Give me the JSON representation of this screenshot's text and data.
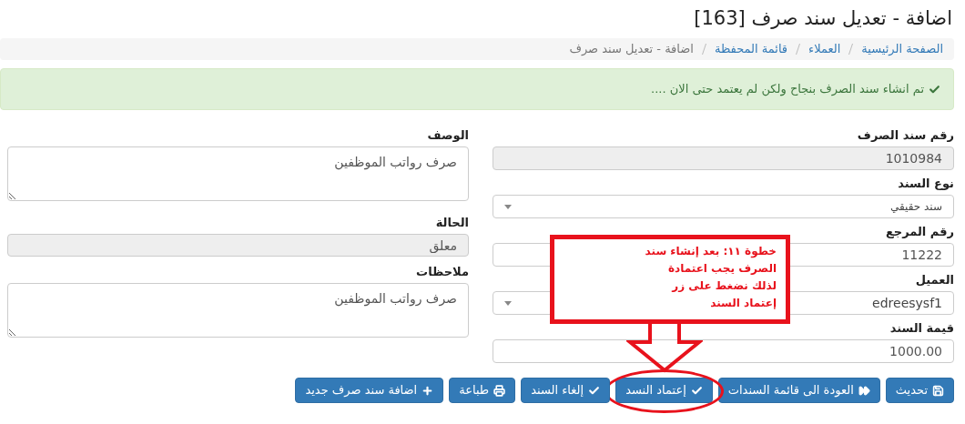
{
  "title": "اضافة - تعديل سند صرف [163]",
  "breadcrumb": [
    {
      "label": "الصفحة الرئيسية",
      "kind": "link"
    },
    {
      "label": "العملاء",
      "kind": "link"
    },
    {
      "label": "قائمة المحفظة",
      "kind": "link"
    },
    {
      "label": "اضافة - تعديل سند صرف",
      "kind": "current"
    }
  ],
  "alert": {
    "text": "تم انشاء سند الصرف بنجاح ولكن لم يعتمد حتى الان ...."
  },
  "right_fields": [
    {
      "label": "رقم سند الصرف",
      "value": "1010984",
      "kind": "input",
      "disabled": true
    },
    {
      "label": "نوع السند",
      "value": "سند حقيقي",
      "kind": "select",
      "disabled": false
    },
    {
      "label": "رقم المرجع",
      "value": "11222",
      "kind": "input",
      "disabled": false
    },
    {
      "label": "العميل",
      "value": "edreesysf1",
      "kind": "select",
      "disabled": false
    },
    {
      "label": "قيمة السند",
      "value": "1000.00",
      "kind": "input",
      "disabled": false
    }
  ],
  "left_fields": [
    {
      "label": "الوصف",
      "value": "صرف رواتب الموظفين",
      "kind": "textarea",
      "disabled": false
    },
    {
      "label": "الحالة",
      "value": "معلق",
      "kind": "input",
      "disabled": true
    },
    {
      "label": "ملاحظات",
      "value": "صرف رواتب الموظفين",
      "kind": "textarea",
      "disabled": false
    }
  ],
  "buttons": [
    {
      "label": "تحديث",
      "kind": "save",
      "highlighted": false
    },
    {
      "label": "العودة الى قائمة السندات",
      "kind": "back",
      "highlighted": false
    },
    {
      "label": "إعتماد النسد",
      "kind": "approve",
      "highlighted": true
    },
    {
      "label": "إلغاء السند",
      "kind": "cancel",
      "highlighted": false
    },
    {
      "label": "طباعة",
      "kind": "print",
      "highlighted": false
    },
    {
      "label": "اضافة سند صرف جديد",
      "kind": "add",
      "highlighted": false
    }
  ],
  "annotation": {
    "text": "خطوة ١١: بعد إنشاء سند الصرف يجب اعتمادة لذلك نضغط على زر إعتماد السند"
  }
}
